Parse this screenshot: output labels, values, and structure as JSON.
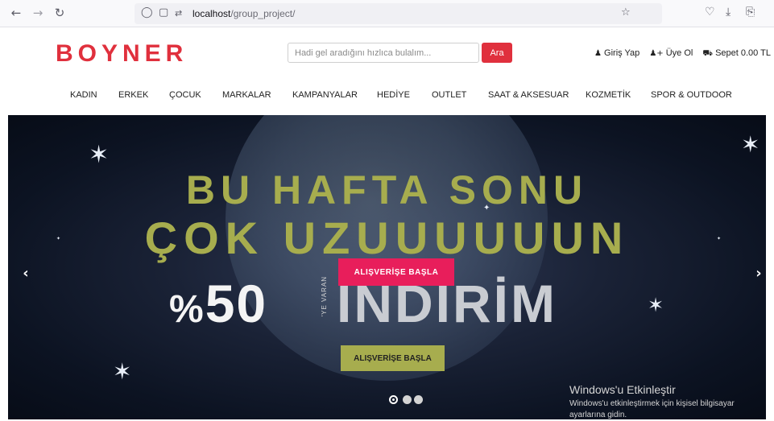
{
  "browser": {
    "url_host": "localhost",
    "url_path": "/group_project/",
    "icons": [
      "back-arrow",
      "forward-arrow",
      "reload",
      "shield",
      "page",
      "permissions",
      "bookmark-star",
      "pocket",
      "download",
      "extensions"
    ]
  },
  "header": {
    "logo": "BOYNER",
    "search_placeholder": "Hadi gel aradığını hızlıca bulalım...",
    "search_button": "Ara",
    "login": "Giriş Yap",
    "signup": "Üye Ol",
    "cart": "Sepet 0.00 TL"
  },
  "categories": [
    "KADIN",
    "ERKEK",
    "ÇOCUK",
    "MARKALAR",
    "KAMPANYALAR",
    "HEDİYE",
    "OUTLET",
    "SAAT & AKSESUAR",
    "KOZMETİK",
    "SPOR & OUTDOOR"
  ],
  "hero": {
    "headline_1": "BU HAFTA SONU",
    "headline_2": "ÇOK UZUUUUUUN",
    "discount_pct": "%",
    "discount_value": "50",
    "vertical_text": "'YE VARAN",
    "discount_word": "İNDİRİM",
    "cta_primary": "ALIŞVERİŞE BAŞLA",
    "cta_secondary": "ALIŞVERİŞE BAŞLA",
    "prev_arrow": "‹",
    "next_arrow": "›",
    "slide_count": 3,
    "active_slide": 1
  },
  "windows_watermark": {
    "title": "Windows'u Etkinleştir",
    "subtitle": "Windows'u etkinleştirmek için kişisel bilgisayar ayarlarına gidin."
  },
  "colors": {
    "brand_red": "#e0303d",
    "hero_olive": "#a7ad4e",
    "cta_pink": "#e81e5b"
  }
}
